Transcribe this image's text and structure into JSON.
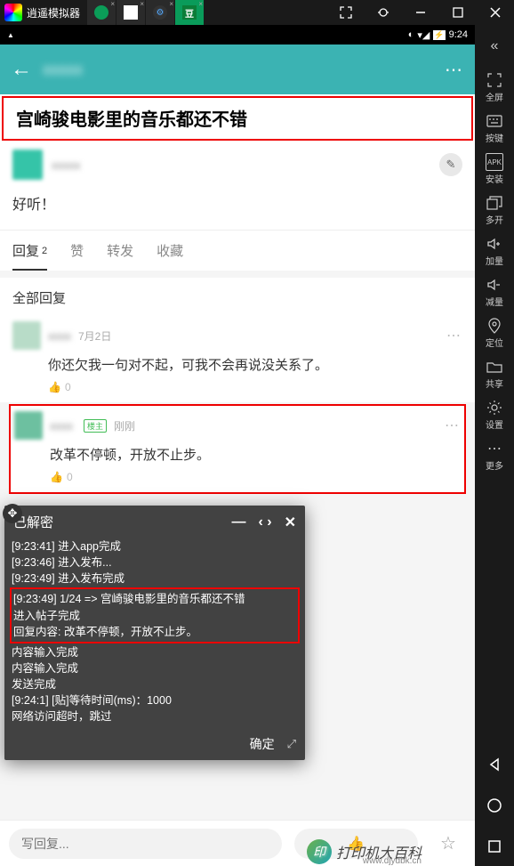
{
  "emulator": {
    "title": "逍遥模拟器",
    "tabs": [
      "360",
      "cam",
      "gear",
      "dou"
    ]
  },
  "sidebar": {
    "items": [
      {
        "label": "全屏"
      },
      {
        "label": "按键"
      },
      {
        "label": "安装",
        "tag": "APK"
      },
      {
        "label": "多开"
      },
      {
        "label": "加量"
      },
      {
        "label": "减量"
      },
      {
        "label": "定位"
      },
      {
        "label": "共享"
      },
      {
        "label": "设置"
      },
      {
        "label": "更多"
      }
    ],
    "expand": "«"
  },
  "status": {
    "time": "9:24"
  },
  "post": {
    "title": "宫崎骏电影里的音乐都还不错",
    "body": "好听！"
  },
  "tabs": {
    "reply": "回复",
    "reply_count": "2",
    "like": "赞",
    "repost": "转发",
    "fav": "收藏"
  },
  "section": {
    "all_replies": "全部回复"
  },
  "replies": [
    {
      "time": "7月2日",
      "body": "你还欠我一句对不起，可我不会再说没关系了。",
      "likes": "0"
    },
    {
      "time": "刚刚",
      "badge": "楼主",
      "body": "改革不停顿，开放不止步。",
      "likes": "0"
    }
  ],
  "console": {
    "title": "已解密",
    "lines_before": [
      "[9:23:41] 进入app完成",
      "[9:23:46] 进入发布...",
      "[9:23:49] 进入发布完成"
    ],
    "highlight": [
      "[9:23:49] 1/24 => 宫崎骏电影里的音乐都还不错",
      "进入帖子完成",
      "回复内容: 改革不停顿，开放不止步。"
    ],
    "lines_after": [
      "内容输入完成",
      "内容输入完成",
      "发送完成",
      "[9:24:1] [贴]等待时间(ms)：1000",
      "网络访问超时，跳过"
    ],
    "ok": "确定"
  },
  "input": {
    "placeholder": "写回复..."
  },
  "watermark": {
    "text": "打印机大百科",
    "url": "www.djydbk.cn"
  }
}
